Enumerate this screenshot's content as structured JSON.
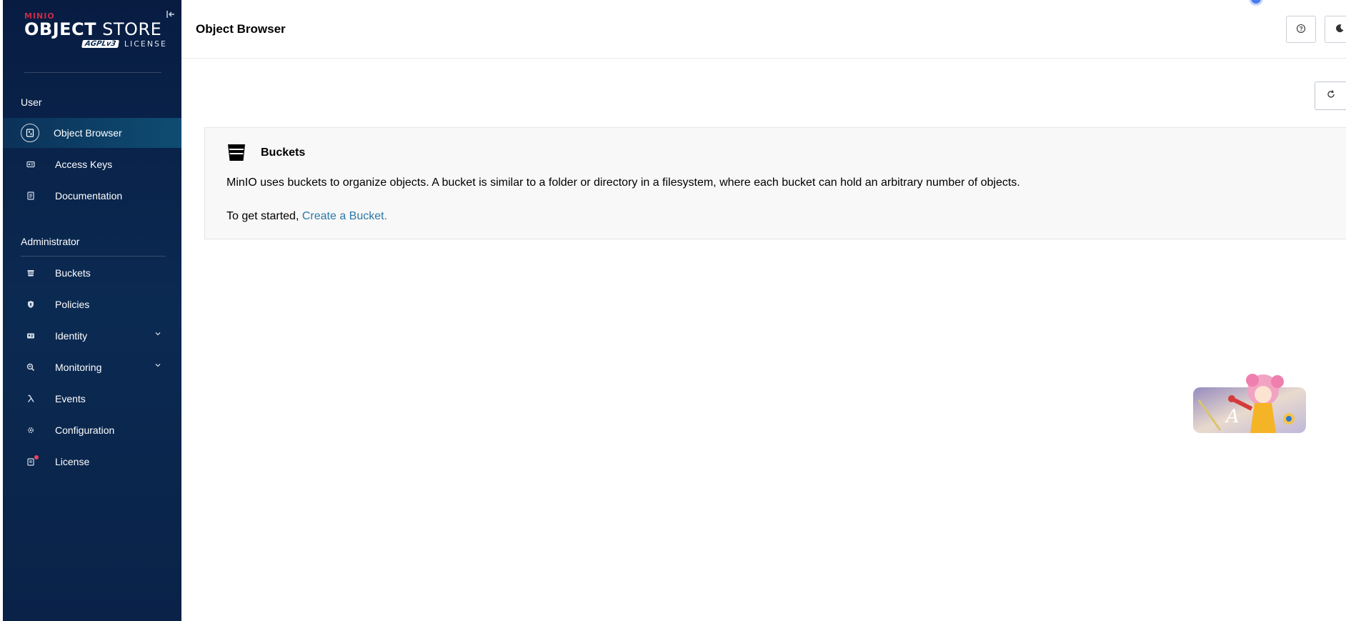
{
  "app": {
    "logo_brand": "MINIO",
    "logo_product_bold": "OBJECT",
    "logo_product": "STORE",
    "logo_agpl": "AGPLv3",
    "logo_license": "LICENSE"
  },
  "sidebar": {
    "user_section": "User",
    "user_items": [
      {
        "label": "Object Browser",
        "icon": "object-browser-icon",
        "active": true
      },
      {
        "label": "Access Keys",
        "icon": "access-keys-icon"
      },
      {
        "label": "Documentation",
        "icon": "documentation-icon"
      }
    ],
    "admin_section": "Administrator",
    "admin_items": [
      {
        "label": "Buckets",
        "icon": "bucket-icon"
      },
      {
        "label": "Policies",
        "icon": "shield-icon"
      },
      {
        "label": "Identity",
        "icon": "identity-icon",
        "expandable": true
      },
      {
        "label": "Monitoring",
        "icon": "monitoring-icon",
        "expandable": true
      },
      {
        "label": "Events",
        "icon": "lambda-icon"
      },
      {
        "label": "Configuration",
        "icon": "gear-icon"
      },
      {
        "label": "License",
        "icon": "license-icon",
        "badge": true
      }
    ]
  },
  "header": {
    "title": "Object Browser"
  },
  "card": {
    "title": "Buckets",
    "description": "MinIO uses buckets to organize objects. A bucket is similar to a folder or directory in a filesystem, where each bucket can hold an arbitrary number of objects.",
    "cta_prefix": "To get started, ",
    "cta_link": "Create a Bucket."
  },
  "mascot": {
    "letter": "A"
  },
  "colors": {
    "sidebar_bg": "#0b2a52",
    "active_bg": "#0f4c72",
    "link": "#2c77a8",
    "brand_red": "#c72c48"
  }
}
